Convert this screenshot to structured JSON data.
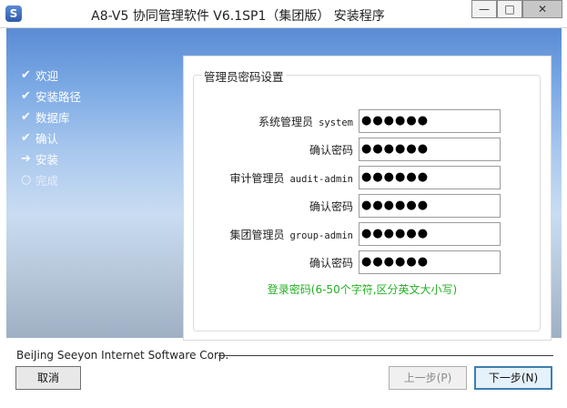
{
  "window": {
    "title": "A8-V5 协同管理软件 V6.1SP1（集团版） 安装程序",
    "icon": "seeyon-app-icon",
    "controls": {
      "minimize": "—",
      "maximize": "□",
      "close": "✕"
    }
  },
  "steps": [
    {
      "label": "欢迎",
      "status": "done",
      "mark": "✔"
    },
    {
      "label": "安装路径",
      "status": "done",
      "mark": "✔"
    },
    {
      "label": "数据库",
      "status": "done",
      "mark": "✔"
    },
    {
      "label": "确认",
      "status": "done",
      "mark": "✔"
    },
    {
      "label": "安装",
      "status": "current",
      "mark": "➔"
    },
    {
      "label": "完成",
      "status": "pending",
      "mark": "○"
    }
  ],
  "form": {
    "group_title": "管理员密码设置",
    "rows": [
      {
        "label": "系统管理员",
        "account": "system",
        "value": "●●●●●●"
      },
      {
        "label": "确认密码",
        "account": "",
        "value": "●●●●●●"
      },
      {
        "label": "审计管理员",
        "account": "audit-admin",
        "value": "●●●●●●"
      },
      {
        "label": "确认密码",
        "account": "",
        "value": "●●●●●●"
      },
      {
        "label": "集团管理员",
        "account": "group-admin",
        "value": "●●●●●●"
      },
      {
        "label": "确认密码",
        "account": "",
        "value": "●●●●●●"
      }
    ],
    "hint": "登录密码(6-50个字符,区分英文大小写)"
  },
  "footer": {
    "company": "BeiJing Seeyon Internet Software Corp.",
    "cancel_label": "取消",
    "prev_label": "上一步(P)",
    "next_label": "下一步(N)"
  },
  "colors": {
    "accent": "#3c7fb1",
    "hint": "#22b022"
  }
}
